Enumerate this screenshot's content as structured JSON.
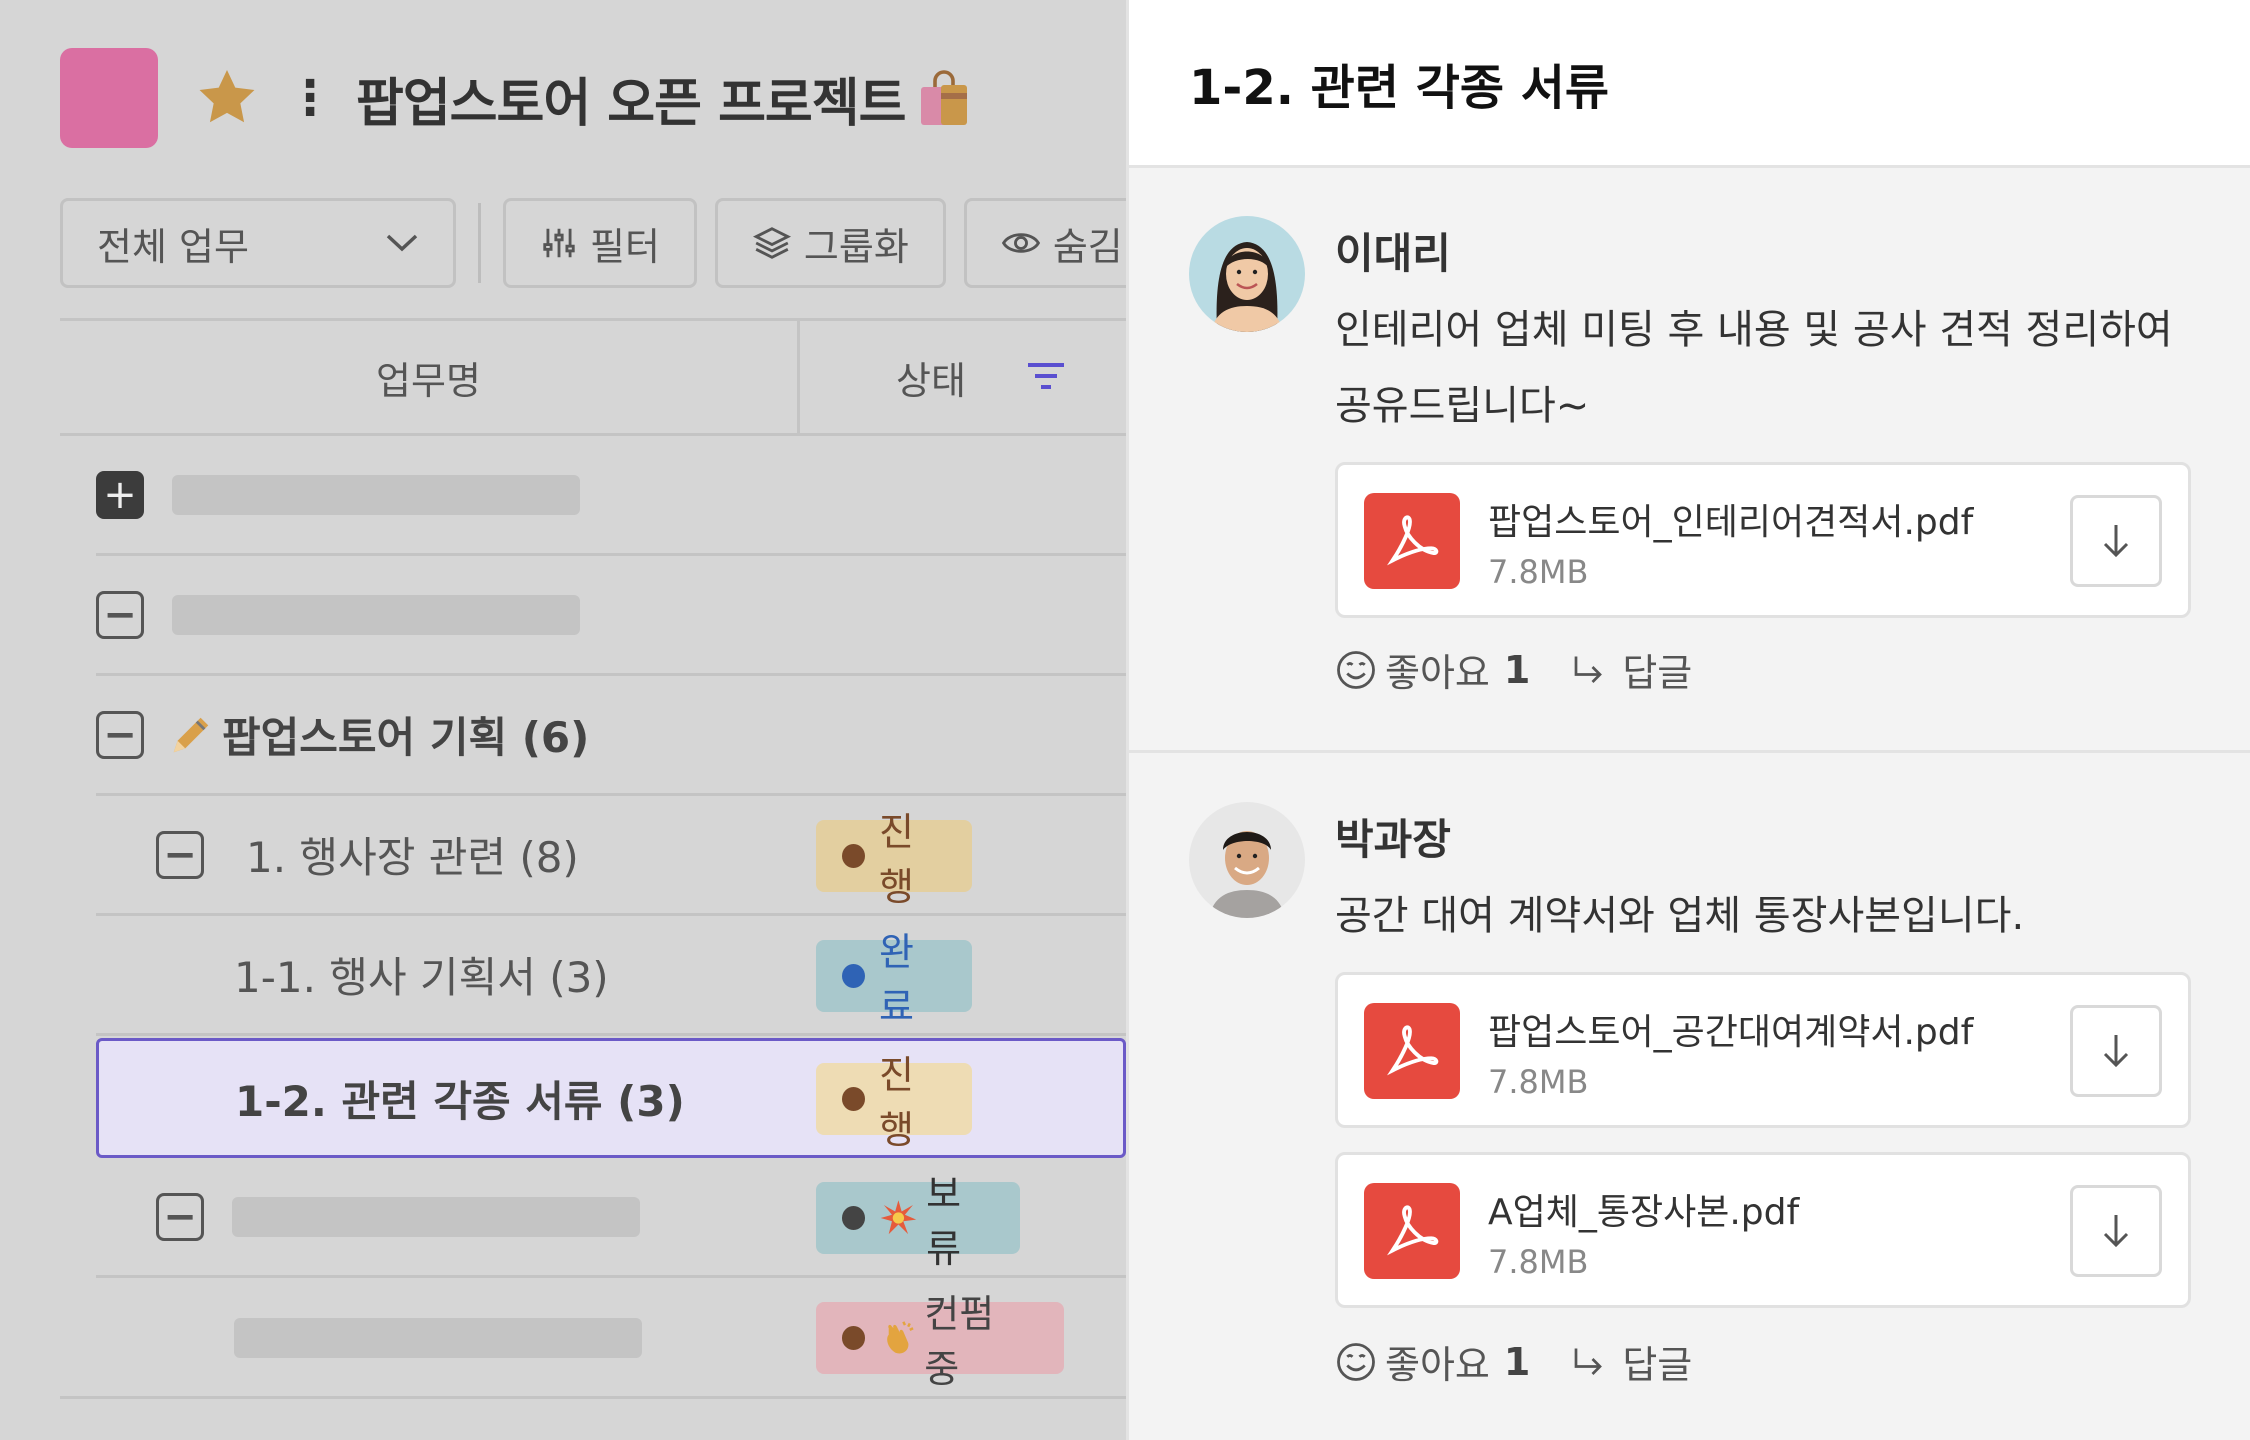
{
  "project": {
    "title": "팝업스토어 오픈 프로젝트",
    "kebab": "⋮"
  },
  "toolbar": {
    "view_select": "전체 업무",
    "filter": "필터",
    "group": "그룹화",
    "hide": "숨김"
  },
  "table": {
    "col_name": "업무명",
    "col_status": "상태"
  },
  "rows": {
    "group": {
      "label": "팝업스토어 기획 (6)"
    },
    "r1": {
      "label": "1. 행사장 관련 (8)",
      "status": "진행"
    },
    "r2": {
      "label": "1-1. 행사 기획서 (3)",
      "status": "완료"
    },
    "r3": {
      "label": "1-2. 관련 각종 서류 (3)",
      "status": "진행"
    },
    "r4": {
      "status": "보류"
    },
    "r5": {
      "status": "컨펌 중"
    }
  },
  "panel": {
    "title": "1-2. 관련 각종 서류",
    "comments": [
      {
        "author": "이대리",
        "text_line1": "인테리어 업체 미팅 후 내용 및 공사 견적 정리하여",
        "text_line2": "공유드립니다~",
        "files": [
          {
            "name": "팝업스토어_인테리어견적서.pdf",
            "size": "7.8MB"
          }
        ],
        "like_label": "좋아요",
        "like_count": "1",
        "reply_label": "답글"
      },
      {
        "author": "박과장",
        "text_line1": "공간 대여 계약서와 업체 통장사본입니다.",
        "files": [
          {
            "name": "팝업스토어_공간대여계약서.pdf",
            "size": "7.8MB"
          },
          {
            "name": "A업체_통장사본.pdf",
            "size": "7.8MB"
          }
        ],
        "like_label": "좋아요",
        "like_count": "1",
        "reply_label": "답글"
      }
    ]
  },
  "colors": {
    "accent": "#6b5ac7",
    "pdf_red": "#e64a3f",
    "project_pink": "#da6fa2"
  },
  "icons": [
    "star-icon",
    "shopping-bag-icon",
    "chevron-down-icon",
    "filter-sliders-icon",
    "layers-icon",
    "eye-icon",
    "sort-filter-icon",
    "pencil-icon",
    "collision-icon",
    "clapping-hands-icon",
    "pdf-icon",
    "download-icon",
    "smile-icon",
    "reply-arrow-icon"
  ]
}
